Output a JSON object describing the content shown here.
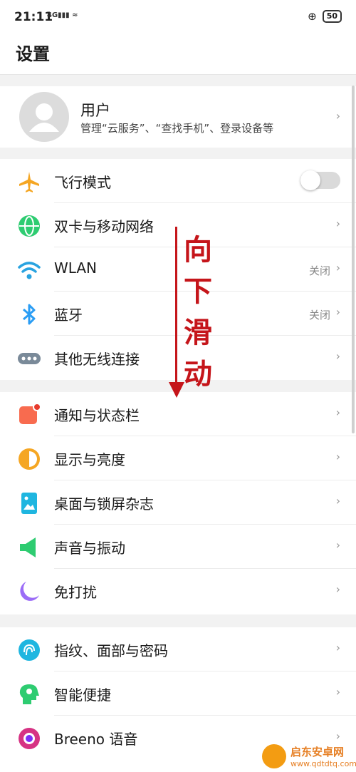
{
  "status_bar": {
    "time": "21:11",
    "network": "4G",
    "battery": "50"
  },
  "header": {
    "title": "设置"
  },
  "profile": {
    "name": "用户",
    "subtitle": "管理“云服务”、“查找手机”、登录设备等"
  },
  "annotation": {
    "text": [
      "向",
      "下",
      "滑",
      "动"
    ],
    "color": "#c5151a"
  },
  "groups": [
    {
      "items": [
        {
          "label": "飞行模式",
          "icon": "airplane-icon",
          "color": "#f5a623",
          "toggle": false
        },
        {
          "label": "双卡与移动网络",
          "icon": "globe-icon",
          "color": "#2ecc71"
        },
        {
          "label": "WLAN",
          "icon": "wifi-icon",
          "color": "#29a3e0",
          "value": "关闭"
        },
        {
          "label": "蓝牙",
          "icon": "bluetooth-icon",
          "color": "#2a9df4",
          "value": "关闭"
        },
        {
          "label": "其他无线连接",
          "icon": "more-icon",
          "color": "#7a8a99"
        }
      ]
    },
    {
      "items": [
        {
          "label": "通知与状态栏",
          "icon": "notification-icon",
          "color": "#f86b4f"
        },
        {
          "label": "显示与亮度",
          "icon": "brightness-icon",
          "color": "#f5a623"
        },
        {
          "label": "桌面与锁屏杂志",
          "icon": "wallpaper-icon",
          "color": "#1fb6e0"
        },
        {
          "label": "声音与振动",
          "icon": "sound-icon",
          "color": "#2ecc71"
        },
        {
          "label": "免打扰",
          "icon": "moon-icon",
          "color": "#9b6cf7"
        }
      ]
    },
    {
      "items": [
        {
          "label": "指纹、面部与密码",
          "icon": "fingerprint-icon",
          "color": "#1fb6e0"
        },
        {
          "label": "智能便捷",
          "icon": "smart-icon",
          "color": "#2ecc71"
        },
        {
          "label": "Breeno 语音",
          "icon": "breeno-icon",
          "color": "#d63384"
        }
      ]
    }
  ],
  "watermark": {
    "title": "启东安卓网",
    "url": "www.qdtdtq.com"
  }
}
